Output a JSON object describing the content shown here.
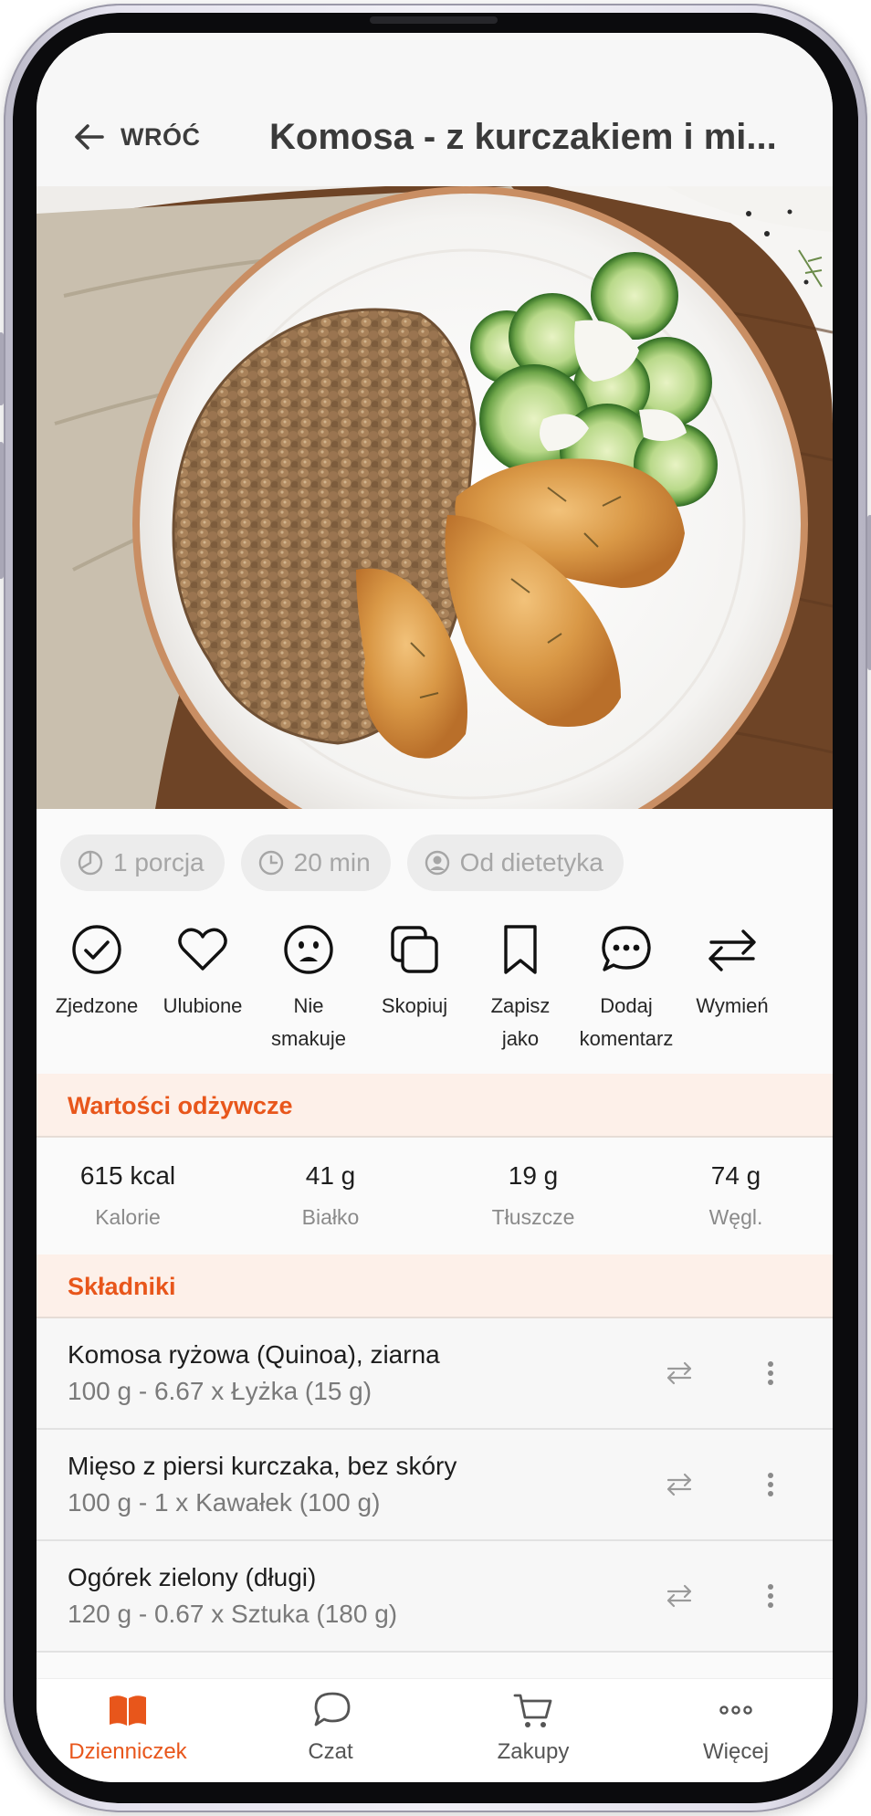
{
  "header": {
    "back_label": "WRÓĆ",
    "title": "Komosa - z kurczakiem i mi..."
  },
  "meta_chips": [
    {
      "icon": "pie-portion-icon",
      "label": "1 porcja"
    },
    {
      "icon": "clock-icon",
      "label": "20 min"
    },
    {
      "icon": "dietitian-user-icon",
      "label": "Od dietetyka"
    }
  ],
  "actions": [
    {
      "icon": "check-circle-icon",
      "label": "Zjedzone"
    },
    {
      "icon": "heart-icon",
      "label": "Ulubione"
    },
    {
      "icon": "sad-face-icon",
      "label": "Nie\nsmakuje"
    },
    {
      "icon": "copy-icon",
      "label": "Skopiuj"
    },
    {
      "icon": "bookmark-icon",
      "label": "Zapisz\njako"
    },
    {
      "icon": "comment-icon",
      "label": "Dodaj\nkomentarz"
    },
    {
      "icon": "swap-arrows-icon",
      "label": "Wymień"
    }
  ],
  "nutrition": {
    "title": "Wartości odżywcze",
    "items": [
      {
        "value": "615 kcal",
        "label": "Kalorie"
      },
      {
        "value": "41 g",
        "label": "Białko"
      },
      {
        "value": "19 g",
        "label": "Tłuszcze"
      },
      {
        "value": "74 g",
        "label": "Węgl."
      }
    ]
  },
  "ingredients": {
    "title": "Składniki",
    "items": [
      {
        "name": "Komosa ryżowa (Quinoa), ziarna",
        "amount": "100 g - 6.67 x Łyżka (15 g)"
      },
      {
        "name": "Mięso z piersi kurczaka, bez skóry",
        "amount": "100 g - 1 x Kawałek (100 g)"
      },
      {
        "name": "Ogórek zielony (długi)",
        "amount": "120 g - 0.67 x Sztuka (180 g)"
      }
    ]
  },
  "bottom_nav": [
    {
      "icon": "book-icon",
      "label": "Dzienniczek",
      "active": true
    },
    {
      "icon": "chat-bubble-icon",
      "label": "Czat"
    },
    {
      "icon": "cart-icon",
      "label": "Zakupy"
    },
    {
      "icon": "more-dots-icon",
      "label": "Więcej"
    }
  ],
  "colors": {
    "accent": "#e8561b",
    "section_background": "#fdf0e9",
    "chip_background": "#ececec"
  }
}
